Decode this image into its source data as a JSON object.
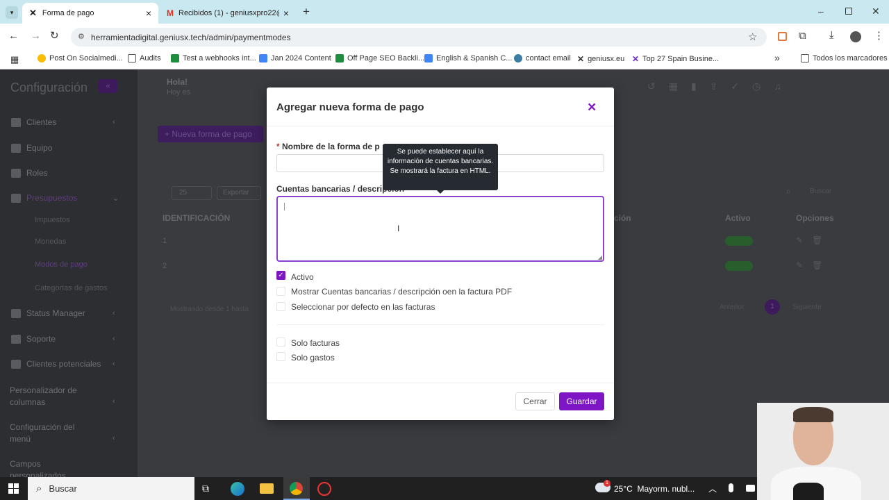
{
  "browser": {
    "tabs": [
      {
        "label": "Forma de pago",
        "close": "×"
      },
      {
        "label": "Recibidos (1) - geniusxpro22@",
        "close": "×"
      }
    ],
    "new_tab": "+",
    "url": "herramientadigital.geniusx.tech/admin/paymentmodes",
    "bookmarks": [
      "Post On Socialmedi...",
      "Audits",
      "Test a webhooks int...",
      "Jan 2024 Content",
      "Off Page SEO Backli...",
      "English & Spanish C...",
      "contact email",
      "geniusx.eu",
      "Top 27 Spain Busine..."
    ],
    "bookmarks_more": "»",
    "all_bookmarks": "Todos los marcadores"
  },
  "app": {
    "title": "Configuración",
    "greeting": "Hola!",
    "greeting_sub": "Hoy es",
    "sidebar": [
      {
        "label": "Clientes",
        "chev": true
      },
      {
        "label": "Equipo",
        "chev": false
      },
      {
        "label": "Roles",
        "chev": false
      },
      {
        "label": "Presupuestos",
        "chev": true
      },
      {
        "label": "Impuestos",
        "chev": false
      },
      {
        "label": "Monedas",
        "chev": false
      },
      {
        "label": "Modos de pago",
        "chev": false
      },
      {
        "label": "Categorías de gastos",
        "chev": false
      },
      {
        "label": "Status Manager",
        "chev": true
      },
      {
        "label": "Soporte",
        "chev": true
      },
      {
        "label": "Clientes potenciales",
        "chev": true
      },
      {
        "label": "Personalizador de columnas",
        "chev": true
      },
      {
        "label": "Configuración del menú",
        "chev": true
      },
      {
        "label": "Campos personalizados",
        "chev": false
      }
    ],
    "new_button": "+ Nueva forma de pago",
    "show": "25",
    "export": "Exportar",
    "search_placeholder": "Buscar",
    "columns": [
      "IDENTIFICACIÓN",
      "ción",
      "Activo",
      "Opciones"
    ],
    "rows": [
      "1",
      "2"
    ],
    "footer_info": "Mostrando desde 1 hasta",
    "pagination": {
      "prev": "Anterior",
      "page": "1",
      "next": "Siguiente"
    }
  },
  "modal": {
    "title": "Agregar nueva forma de pago",
    "close": "×",
    "name_label": "Nombre de la forma de p",
    "required_mark": "*",
    "name_value": "",
    "desc_label": "Cuentas bancarias / descripción",
    "desc_value": "",
    "tooltip": "Se puede establecer aquí la información de cuentas bancarias. Se mostrará la factura en HTML.",
    "checkboxes": [
      {
        "label": "Activo",
        "checked": true
      },
      {
        "label": "Mostrar Cuentas bancarias / descripción oen la factura PDF",
        "checked": false
      },
      {
        "label": "Seleccionar por defecto en las facturas",
        "checked": false
      },
      {
        "label": "Solo facturas",
        "checked": false
      },
      {
        "label": "Solo gastos",
        "checked": false
      }
    ],
    "cancel": "Cerrar",
    "save": "Guardar"
  },
  "taskbar": {
    "search": "Buscar",
    "weather": "25°C  Mayorm. nubl...",
    "weather_badge": "1"
  },
  "colors": {
    "accent": "#7e16c5",
    "tabbar": "#c9e8f0"
  }
}
